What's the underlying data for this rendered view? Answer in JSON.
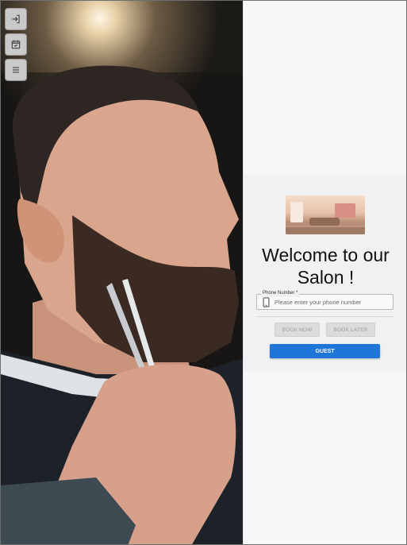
{
  "sidebar": {
    "buttons": [
      {
        "name": "login",
        "icon": "login-icon"
      },
      {
        "name": "calendar",
        "icon": "calendar-check-icon"
      },
      {
        "name": "menu",
        "icon": "hamburger-menu-icon"
      }
    ]
  },
  "hero": {
    "image": "barber-trimming-beard-photo"
  },
  "welcome": {
    "title": "Welcome to our Salon !",
    "salon_image": "salon-interior-photo"
  },
  "form": {
    "phone_label": "Phone Number *",
    "phone_placeholder": "Please enter your phone number",
    "phone_value": ""
  },
  "actions": {
    "book_now": "BOOK NOW",
    "book_later": "BOOK LATER",
    "guest": "GUEST"
  },
  "colors": {
    "primary": "#1d76d8",
    "panel_bg": "#f7f7fa",
    "card_bg": "#f1f1f4",
    "disabled_bg": "#dcdcdc"
  }
}
